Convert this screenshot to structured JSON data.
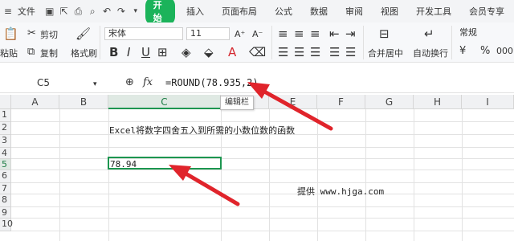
{
  "menubar": {
    "file_label": "文件",
    "start_label": "开始",
    "tabs": [
      "插入",
      "页面布局",
      "公式",
      "数据",
      "审阅",
      "视图",
      "开发工具",
      "会员专享"
    ]
  },
  "ribbon": {
    "paste_label": "粘贴",
    "cut_label": "剪切",
    "copy_label": "复制",
    "format_painter_label": "格式刷",
    "font_name": "宋体",
    "font_size": "11",
    "merge_label": "合并居中",
    "wrap_label": "自动换行",
    "number_format": "常规",
    "currency_symbol": "¥",
    "percent_symbol": "%",
    "thousands_symbol": "000"
  },
  "formula_bar": {
    "name_box": "C5",
    "fx_label": "fx",
    "formula": "=ROUND(78.935,2)",
    "tooltip": "编辑栏"
  },
  "sheet": {
    "columns": [
      "A",
      "B",
      "C",
      "D",
      "E",
      "F",
      "G",
      "H",
      "I"
    ],
    "rows": [
      "1",
      "2",
      "3",
      "4",
      "5",
      "6",
      "7",
      "8",
      "9",
      "10"
    ],
    "cells": {
      "C2": "Excel将数字四舍五入到所需的小数位数的函数",
      "C5": "78.94",
      "F7": "提供 www.hjga.com"
    }
  },
  "colors": {
    "accent": "#1bb35a",
    "selection": "#1d9650",
    "arrow": "#e0242b"
  }
}
